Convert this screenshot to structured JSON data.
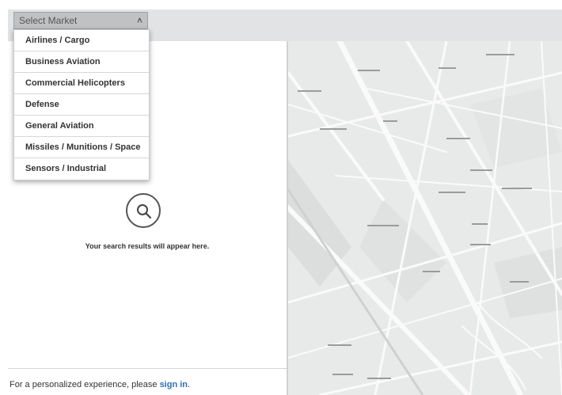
{
  "market_select": {
    "placeholder": "Select Market",
    "chevron_icon": "chevron-up-icon",
    "options": [
      "Airlines / Cargo",
      "Business Aviation",
      "Commercial Helicopters",
      "Defense",
      "General Aviation",
      "Missiles / Munitions / Space",
      "Sensors / Industrial"
    ]
  },
  "results": {
    "icon": "search-icon",
    "empty_message": "Your search results will appear here."
  },
  "footer": {
    "prefix": "For a personalized experience, please ",
    "link": "sign in",
    "suffix": "."
  },
  "map": {
    "icon": "map-view"
  }
}
